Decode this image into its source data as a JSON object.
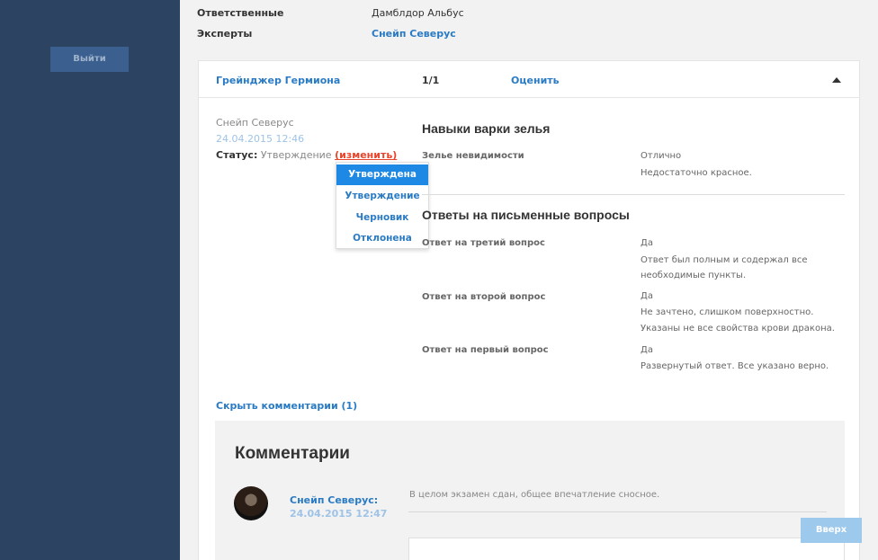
{
  "sidebar": {
    "logout_label": "Выйти"
  },
  "meta": {
    "responsible_label": "Ответственные",
    "responsible_value": "Дамблдор Альбус",
    "experts_label": "Эксперты",
    "experts_value": "Снейп Северус"
  },
  "card": {
    "student": "Грейнджер Гермиона",
    "progress": "1/1",
    "rate_link": "Оценить",
    "reviewer": "Снейп Северус",
    "review_date": "24.04.2015 12:46",
    "status_label": "Статус:",
    "status_value": "Утверждение",
    "change_link": "(изменить)",
    "status_options": [
      "Утверждена",
      "Утверждение",
      "Черновик",
      "Отклонена"
    ],
    "section1": {
      "title": "Навыки варки зелья",
      "items": [
        {
          "question": "Зелье невидимости",
          "grade": "Отлично",
          "comment": "Недостаточно красное."
        }
      ]
    },
    "section2": {
      "title": "Ответы на письменные вопросы",
      "items": [
        {
          "question": "Ответ на третий вопрос",
          "grade": "Да",
          "comment1": "Ответ был полным и содержал все",
          "comment2": "необходимые пункты."
        },
        {
          "question": "Ответ на второй вопрос",
          "grade": "Да",
          "comment1": "Не зачтено, слишком поверхностно.",
          "comment2": "Указаны не все свойства крови дракона."
        },
        {
          "question": "Ответ на первый вопрос",
          "grade": "Да",
          "comment1": "Развернутый ответ. Все указано верно."
        }
      ]
    },
    "hide_comments_link": "Скрыть комментарии (1)"
  },
  "comments": {
    "title": "Комментарии",
    "items": [
      {
        "author": "Снейп Северус:",
        "date": "24.04.2015 12:47",
        "text": "В целом экзамен сдан, общее впечатление сносное."
      }
    ]
  },
  "up_button": "Вверх"
}
